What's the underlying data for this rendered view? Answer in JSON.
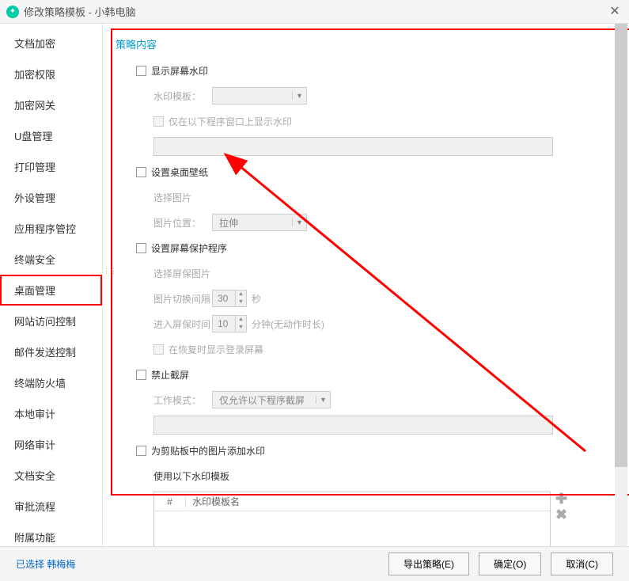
{
  "window": {
    "title": "修改策略模板 - 小韩电脑"
  },
  "sidebar": {
    "items": [
      "文档加密",
      "加密权限",
      "加密网关",
      "U盘管理",
      "打印管理",
      "外设管理",
      "应用程序管控",
      "终端安全",
      "桌面管理",
      "网站访问控制",
      "邮件发送控制",
      "终端防火墙",
      "本地审计",
      "网络审计",
      "文档安全",
      "审批流程",
      "附属功能"
    ],
    "selected_index": 8
  },
  "content": {
    "section_title": "策略内容",
    "watermark": {
      "label": "显示屏幕水印",
      "template_label": "水印模板：",
      "template_value": "",
      "only_programs_label": "仅在以下程序窗口上显示水印"
    },
    "wallpaper": {
      "label": "设置桌面壁纸",
      "choose_image": "选择图片",
      "position_label": "图片位置：",
      "position_value": "拉伸"
    },
    "screensaver": {
      "label": "设置屏幕保护程序",
      "choose_image": "选择屏保图片",
      "interval_label": "图片切换间隔",
      "interval_value": "30",
      "interval_unit": "秒",
      "enter_label": "进入屏保时间",
      "enter_value": "10",
      "enter_unit": "分钟(无动作时长)",
      "restore_login": "在恢复时显示登录屏幕"
    },
    "screenshot": {
      "label": "禁止截屏",
      "mode_label": "工作模式：",
      "mode_value": "仅允许以下程序截屏"
    },
    "clipboard": {
      "label": "为剪贴板中的图片添加水印",
      "subheading": "使用以下水印模板",
      "col_num": "#",
      "col_name": "水印模板名"
    }
  },
  "footer": {
    "status": "已选择 韩梅梅",
    "export": "导出策略(E)",
    "ok": "确定(O)",
    "cancel": "取消(C)"
  }
}
